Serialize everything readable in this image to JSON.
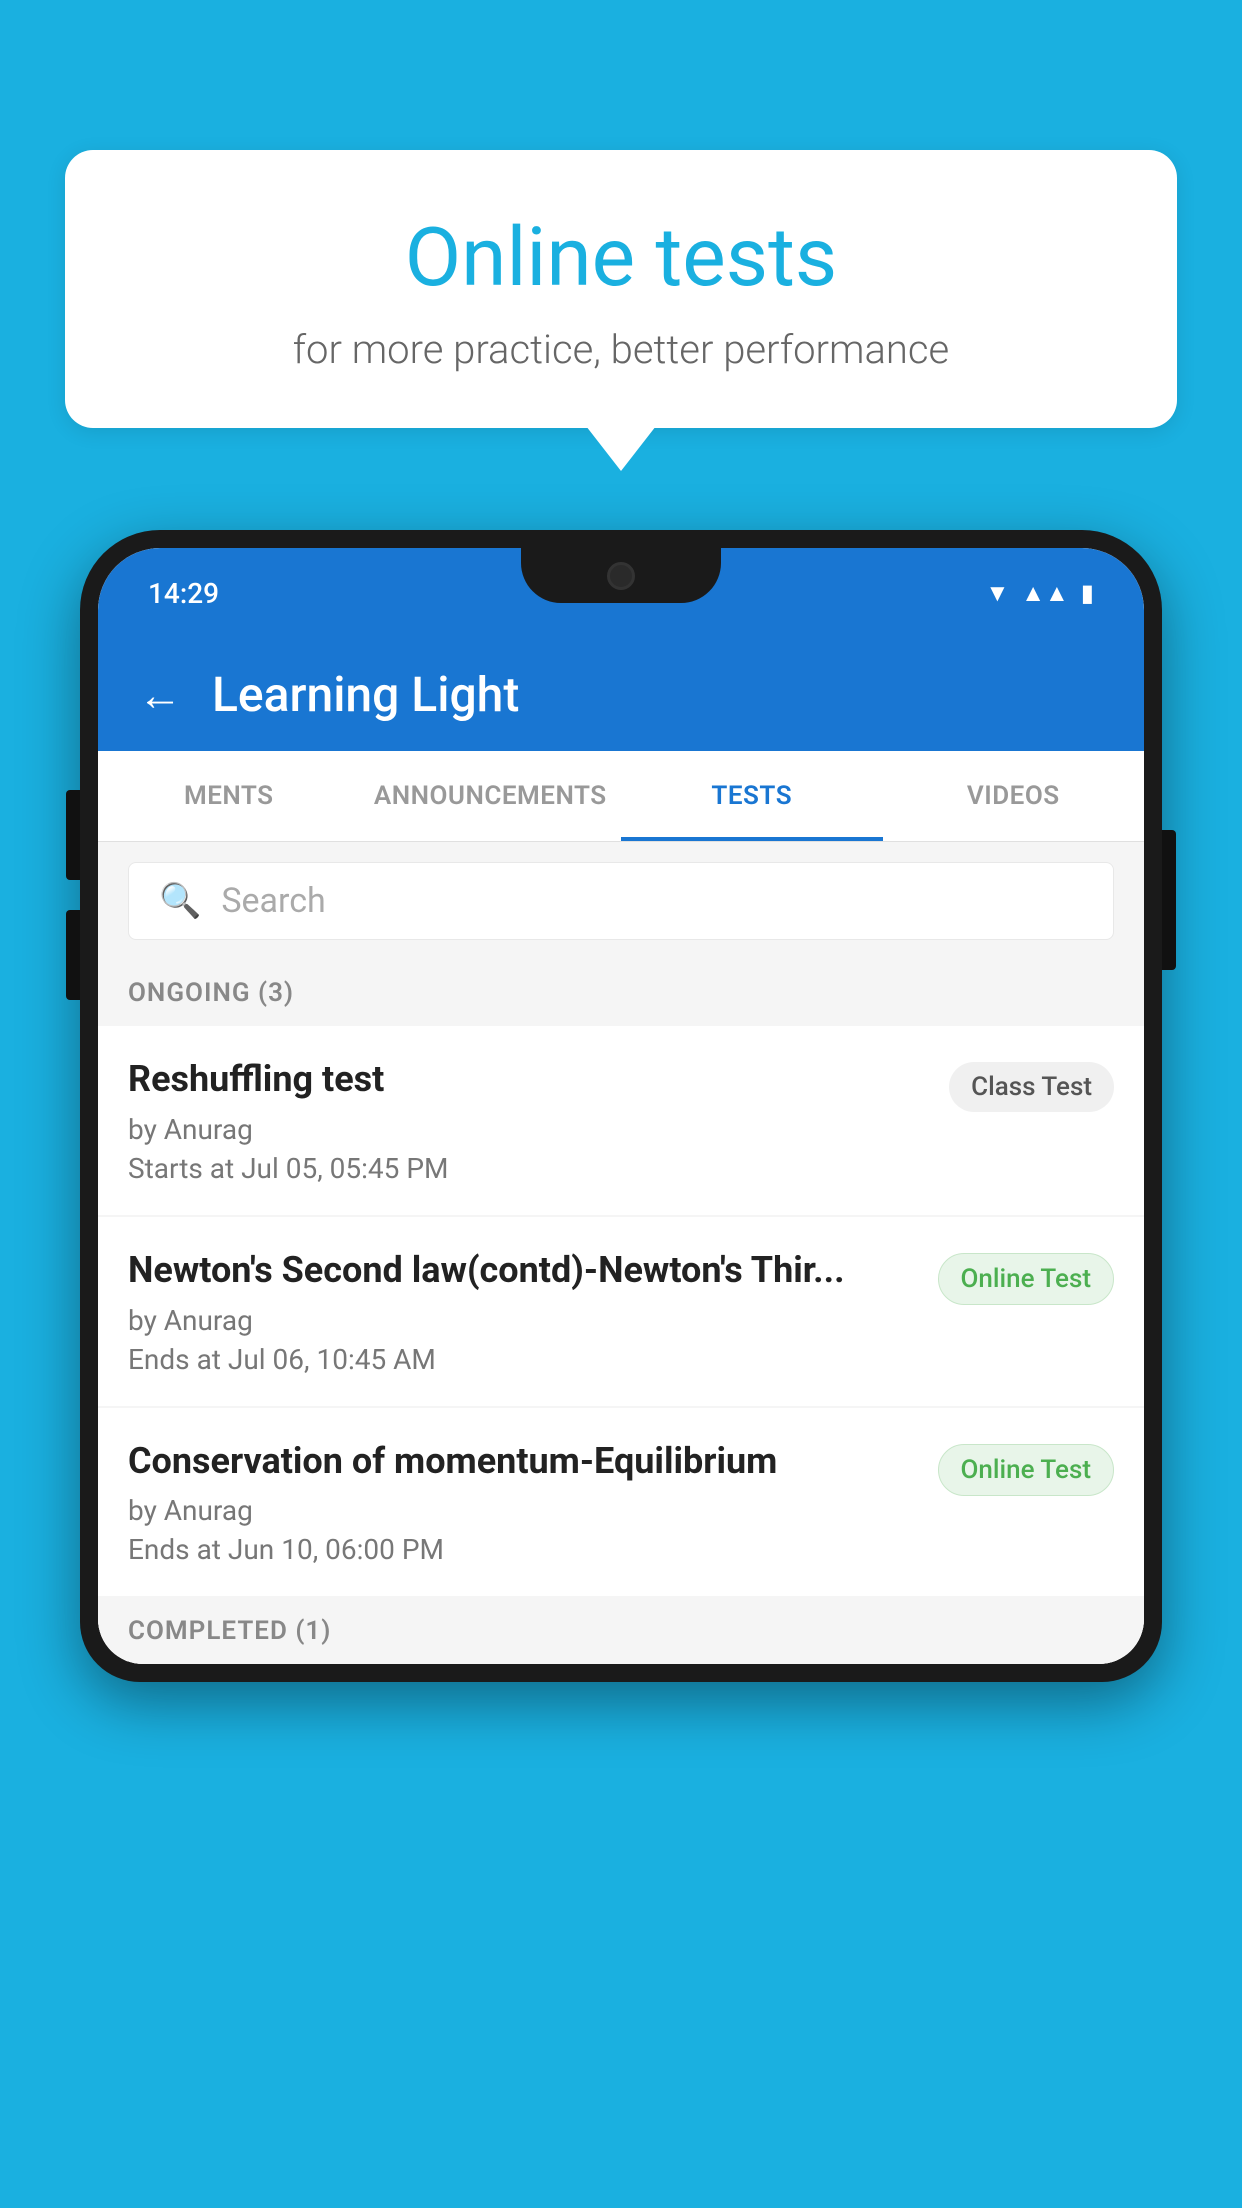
{
  "background_color": "#1ab0e0",
  "bubble": {
    "title": "Online tests",
    "subtitle": "for more practice, better performance"
  },
  "phone": {
    "status_time": "14:29",
    "app_title": "Learning Light",
    "back_label": "←",
    "tabs": [
      {
        "label": "MENTS",
        "active": false
      },
      {
        "label": "ANNOUNCEMENTS",
        "active": false
      },
      {
        "label": "TESTS",
        "active": true
      },
      {
        "label": "VIDEOS",
        "active": false
      }
    ],
    "search_placeholder": "Search",
    "section_ongoing": "ONGOING (3)",
    "tests": [
      {
        "title": "Reshuffling test",
        "author": "by Anurag",
        "time_label": "Starts at",
        "time": "Jul 05, 05:45 PM",
        "badge": "Class Test",
        "badge_type": "class"
      },
      {
        "title": "Newton's Second law(contd)-Newton's Thir...",
        "author": "by Anurag",
        "time_label": "Ends at",
        "time": "Jul 06, 10:45 AM",
        "badge": "Online Test",
        "badge_type": "online"
      },
      {
        "title": "Conservation of momentum-Equilibrium",
        "author": "by Anurag",
        "time_label": "Ends at",
        "time": "Jun 10, 06:00 PM",
        "badge": "Online Test",
        "badge_type": "online"
      }
    ],
    "section_completed": "COMPLETED (1)"
  }
}
